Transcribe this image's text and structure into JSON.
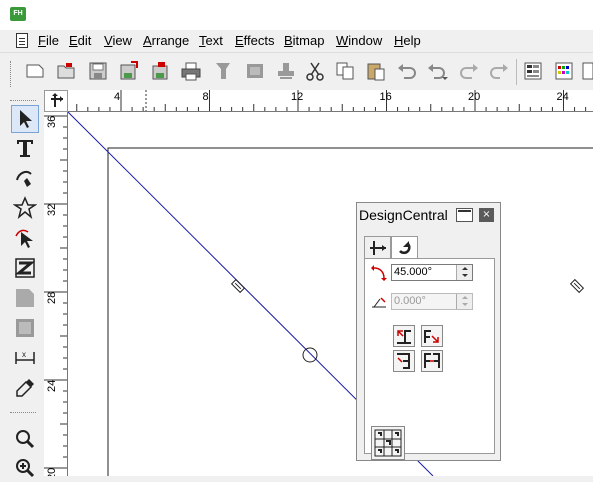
{
  "app": {
    "logo_text": "FH"
  },
  "menu": [
    {
      "label": "File",
      "name": "menu-file"
    },
    {
      "label": "Edit",
      "name": "menu-edit"
    },
    {
      "label": "View",
      "name": "menu-view"
    },
    {
      "label": "Arrange",
      "name": "menu-arrange"
    },
    {
      "label": "Text",
      "name": "menu-text"
    },
    {
      "label": "Effects",
      "name": "menu-effects"
    },
    {
      "label": "Bitmap",
      "name": "menu-bitmap"
    },
    {
      "label": "Window",
      "name": "menu-window"
    },
    {
      "label": "Help",
      "name": "menu-help"
    }
  ],
  "toolbar_icons": [
    "new-document-icon",
    "open-icon",
    "save-icon",
    "save-as-icon",
    "export-icon",
    "print-icon",
    "import-icon",
    "stamp-icon",
    "paste-special-icon",
    "cut-icon",
    "copy-icon",
    "paste-icon",
    "undo-icon",
    "undo-list-icon",
    "redo-icon",
    "redo-list-icon",
    "object-properties-icon",
    "color-palette-icon",
    "more-icon"
  ],
  "toolbox_icons": [
    "pointer-tool-icon",
    "text-tool-icon",
    "pen-tool-icon",
    "star-tool-icon",
    "node-edit-tool-icon",
    "zoom-tool-z-icon",
    "shape-tool-icon",
    "frame-tool-icon",
    "dimension-tool-icon",
    "eyedropper-tool-icon",
    "zoom-tool-icon",
    "zoom-in-icon"
  ],
  "ruler_top": {
    "labels": [
      "4",
      "8",
      "12",
      "16",
      "20",
      "24"
    ]
  },
  "ruler_left": {
    "labels": [
      "36",
      "32",
      "28",
      "24",
      "20"
    ]
  },
  "panel": {
    "title": "DesignCentral",
    "close_label": "×",
    "tabs": [
      {
        "name": "tab-position",
        "icon": "move-icon"
      },
      {
        "name": "tab-rotate",
        "icon": "rotate-icon"
      }
    ],
    "rotation_value": "45.000°",
    "skew_value": "0.000°"
  },
  "colors": {
    "guide_line": "#1a1aa8",
    "canvas": "#ffffff",
    "workspace": "#f0f0f0",
    "flip_accent": "#cc0000"
  }
}
